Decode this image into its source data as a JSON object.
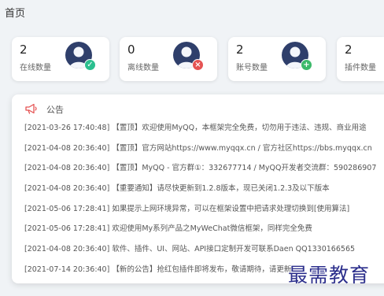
{
  "page": {
    "title": "首页"
  },
  "stats": [
    {
      "value": "2",
      "label": "在线数量",
      "badge": "✓",
      "badge_icon": "check-icon"
    },
    {
      "value": "0",
      "label": "离线数量",
      "badge": "×",
      "badge_icon": "close-icon"
    },
    {
      "value": "2",
      "label": "账号数量",
      "badge": "+",
      "badge_icon": "plus-icon"
    },
    {
      "value": "2",
      "label": "插件数量"
    }
  ],
  "notice": {
    "icon": "megaphone-icon",
    "title": "公告",
    "items": [
      "[2021-03-26 17:40:48] 【置顶】欢迎使用MyQQ，本框架完全免费，切勿用于违法、违规、商业用途",
      "[2021-04-08 20:36:40] 【置顶】官方网站https://www.myqqx.cn / 官方社区https://bbs.myqqx.cn",
      "[2021-04-08 20:36:40] 【置顶】MyQQ - 官方群①：332677714 / MyQQ开发者交流群：590286907",
      "[2021-04-08 20:36:40] 【重要通知】请尽快更新到1.2.8版本，现已关闭1.2.3及以下版本",
      "[2021-05-06 17:28:41] 如果提示上网环境异常，可以在框架设置中把请求处理切换到[使用算法]",
      "[2021-05-06 17:28:41] 欢迎使用My系列产品之MyWeChat微信框架，同样完全免费",
      "[2021-04-08 20:36:40] 软件、插件、UI、网站、API接口定制开发可联系Daen QQ1330166565",
      "[2021-07-14 20:36:40] 【新的公告】抢红包插件即将发布，敬请期待，请更新"
    ]
  },
  "watermark": "最需教育",
  "colors": {
    "page_bg": "#f0f3f6",
    "avatar": "#2f3f6b",
    "online": "#2bbf8f",
    "offline": "#e55353",
    "add": "#3cb96a",
    "accent": "#e55353"
  }
}
